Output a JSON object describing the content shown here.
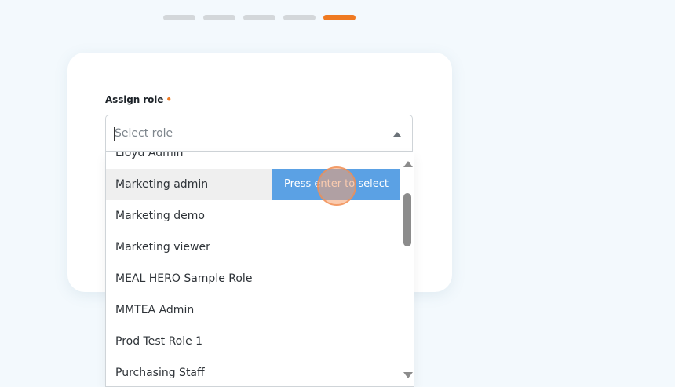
{
  "stepper": {
    "total": 5,
    "current": 5,
    "active_color": "#ef7a22",
    "inactive_color": "#d3d7da"
  },
  "form": {
    "label": "Assign role",
    "required_mark": "•",
    "placeholder": "Select role"
  },
  "dropdown": {
    "options": [
      "Lloyd Admin",
      "Marketing admin",
      "Marketing demo",
      "Marketing viewer",
      "MEAL HERO Sample Role",
      "MMTEA Admin",
      "Prod Test Role 1",
      "Purchasing Staff"
    ],
    "highlighted_index": 1,
    "hint": "Press enter to select",
    "hint_color": "#5ba1e4"
  }
}
